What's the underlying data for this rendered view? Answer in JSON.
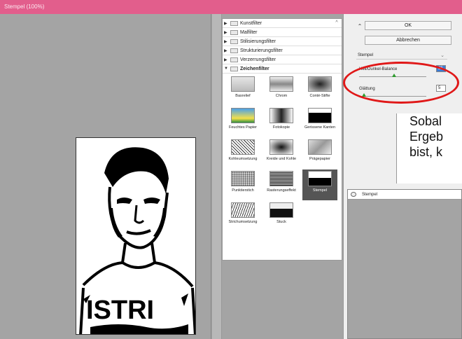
{
  "window": {
    "title": "Stempel (100%)"
  },
  "filter_groups": [
    {
      "label": "Kunstfilter",
      "open": false
    },
    {
      "label": "Malfilter",
      "open": false
    },
    {
      "label": "Stilisierungsfilter",
      "open": false
    },
    {
      "label": "Strukturierungsfilter",
      "open": false
    },
    {
      "label": "Verzerrungsfilter",
      "open": false
    },
    {
      "label": "Zeichenfilter",
      "open": true
    }
  ],
  "thumbnails": [
    {
      "label": "Basrelief"
    },
    {
      "label": "Chrom"
    },
    {
      "label": "Conté-Stifte"
    },
    {
      "label": "Feuchtes Papier"
    },
    {
      "label": "Fotokopie"
    },
    {
      "label": "Gerissene Kanten"
    },
    {
      "label": "Kohleumsetzung"
    },
    {
      "label": "Kreide und Kohle"
    },
    {
      "label": "Prägepapier"
    },
    {
      "label": "Punktierstich"
    },
    {
      "label": "Rasterungseffekt"
    },
    {
      "label": "Stempel",
      "selected": true
    },
    {
      "label": "Strichumsetzung"
    },
    {
      "label": "Stuck"
    }
  ],
  "buttons": {
    "ok": "OK",
    "cancel": "Abbrechen"
  },
  "filter_select": {
    "value": "Stempel"
  },
  "params": {
    "balance_label": "Hell/Dunkel-Balance",
    "balance_value": "25",
    "smooth_label": "Glättung",
    "smooth_value": "5"
  },
  "tooltip": {
    "line1": "Sobal",
    "line2": "Ergeb",
    "line3": "bist, k"
  },
  "layers": {
    "row_label": "Stempel"
  },
  "colors": {
    "titlebar": "#e25e8c",
    "highlight": "#e01818",
    "slider": "#2e9b2e"
  }
}
